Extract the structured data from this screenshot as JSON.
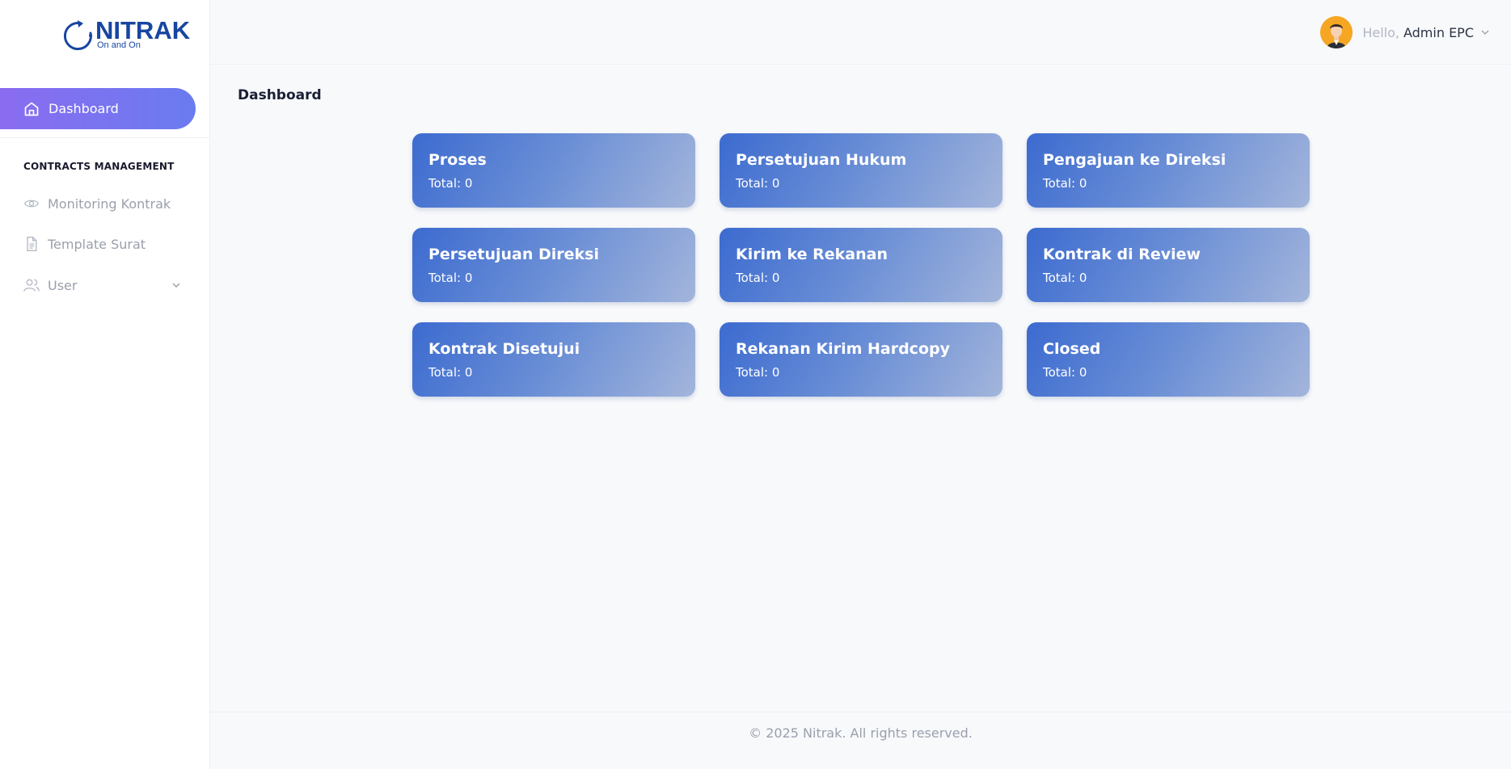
{
  "brand": {
    "name": "NITRAK",
    "tagline": "On and On",
    "color": "#1746a2"
  },
  "sidebar": {
    "active_item": {
      "label": "Dashboard",
      "icon": "home-icon"
    },
    "section_title": "CONTRACTS MANAGEMENT",
    "items": [
      {
        "label": "Monitoring Kontrak",
        "icon": "eye-icon"
      },
      {
        "label": "Template Surat",
        "icon": "document-icon"
      },
      {
        "label": "User",
        "icon": "users-icon",
        "has_submenu": true
      }
    ]
  },
  "header": {
    "greeting": "Hello,",
    "user_name": "Admin EPC"
  },
  "main": {
    "page_title": "Dashboard",
    "cards": [
      {
        "title": "Proses",
        "total": "Total: 0"
      },
      {
        "title": "Persetujuan Hukum",
        "total": "Total: 0"
      },
      {
        "title": "Pengajuan ke Direksi",
        "total": "Total: 0"
      },
      {
        "title": "Persetujuan Direksi",
        "total": "Total: 0"
      },
      {
        "title": "Kirim ke Rekanan",
        "total": "Total: 0"
      },
      {
        "title": "Kontrak di Review",
        "total": "Total: 0"
      },
      {
        "title": "Kontrak Disetujui",
        "total": "Total: 0"
      },
      {
        "title": "Rekanan Kirim Hardcopy",
        "total": "Total: 0"
      },
      {
        "title": "Closed",
        "total": "Total: 0"
      }
    ]
  },
  "footer": {
    "text": "© 2025 Nitrak. All rights reserved."
  },
  "colors": {
    "accent_start": "#8a6cf0",
    "accent_end": "#6a7bf0",
    "card_start": "#3c6bd0",
    "card_end": "#a3b5db"
  }
}
